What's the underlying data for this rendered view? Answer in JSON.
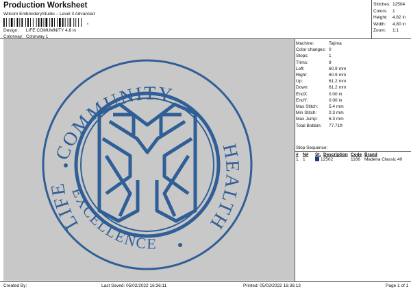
{
  "header": {
    "title": "Production Worksheet",
    "subtitle": "Wilcom EmbroideryStudio – Level 3 Advanced",
    "barcode_suffix": ",",
    "design_label": "Design:",
    "design_value": "LIFE COMUMNITY 4,8 in",
    "colorway_label": "Colorway:",
    "colorway_value": "Colorway 1"
  },
  "summary": [
    {
      "k": "Stitches:",
      "v": "12504"
    },
    {
      "k": "Colors:",
      "v": "1"
    },
    {
      "k": "Height:",
      "v": "4.82 in"
    },
    {
      "k": "Width:",
      "v": "4.80 in"
    },
    {
      "k": "Zoom:",
      "v": "1:1"
    }
  ],
  "machine_info": [
    {
      "k": "Machine:",
      "v": "Tajima"
    },
    {
      "k": "Color changes:",
      "v": "0"
    },
    {
      "k": "Stops:",
      "v": "1"
    },
    {
      "k": "Trims:",
      "v": "9"
    },
    {
      "k": "Left:",
      "v": "60.9 mm"
    },
    {
      "k": "Right:",
      "v": "60.9 mm"
    },
    {
      "k": "Up:",
      "v": "61.2 mm"
    },
    {
      "k": "Down:",
      "v": "61.2 mm"
    },
    {
      "k": "EndX:",
      "v": "0.00 in"
    },
    {
      "k": "EndY:",
      "v": "0.00 in"
    },
    {
      "k": "Max Stitch:",
      "v": "5.4 mm"
    },
    {
      "k": "Min Stitch:",
      "v": "0.3 mm"
    },
    {
      "k": "Max Jump:",
      "v": "6.3 mm"
    },
    {
      "k": "Total Bobbin:",
      "v": "77.71ft"
    }
  ],
  "stop_sequence": {
    "title": "Stop Sequence:",
    "columns": [
      "#",
      "N#",
      "St.",
      "Description",
      "Code",
      "Brand"
    ],
    "rows": [
      {
        "idx": "1.",
        "n": "1",
        "st": "12502",
        "desc": "",
        "code": "1166",
        "brand": "Madeira Classic 40",
        "color": "#1a3d7a"
      }
    ]
  },
  "design_text": {
    "top": "COMMUNITY",
    "left": "LIFE",
    "right": "HEALTH",
    "bottom": "EXCELLENCE",
    "thread_color": "#2f5f96"
  },
  "footer": {
    "created_by": "Created By:",
    "last_saved": "Last Saved: 05/02/2022 16:36:11",
    "printed": "Printed: 05/02/2022 16:36:13",
    "page": "Page 1 of 1"
  }
}
